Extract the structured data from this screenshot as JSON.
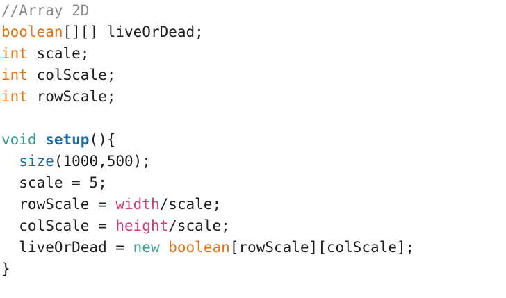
{
  "editor": {
    "colors": {
      "comment": "#8a8a8a",
      "type": "#e0761a",
      "void": "#3a9d8f",
      "function": "#1b6ba5",
      "constant": "#d23d7a",
      "text": "#1f1f1f",
      "background": "#ffffff"
    },
    "lines": [
      [
        {
          "t": "//Array 2D",
          "k": "comment"
        }
      ],
      [
        {
          "t": "boolean",
          "k": "type"
        },
        {
          "t": "[][] liveOrDead;",
          "k": "plain"
        }
      ],
      [
        {
          "t": "int",
          "k": "type"
        },
        {
          "t": " scale;",
          "k": "plain"
        }
      ],
      [
        {
          "t": "int",
          "k": "type"
        },
        {
          "t": " colScale;",
          "k": "plain"
        }
      ],
      [
        {
          "t": "int",
          "k": "type"
        },
        {
          "t": " rowScale;",
          "k": "plain"
        }
      ],
      [],
      [
        {
          "t": "void",
          "k": "void"
        },
        {
          "t": " ",
          "k": "plain"
        },
        {
          "t": "setup",
          "k": "func"
        },
        {
          "t": "(){",
          "k": "plain"
        }
      ],
      [
        {
          "t": "  ",
          "k": "plain"
        },
        {
          "t": "size",
          "k": "builtin"
        },
        {
          "t": "(1000,500);",
          "k": "plain"
        }
      ],
      [
        {
          "t": "  scale = 5;",
          "k": "plain"
        }
      ],
      [
        {
          "t": "  rowScale = ",
          "k": "plain"
        },
        {
          "t": "width",
          "k": "const"
        },
        {
          "t": "/scale;",
          "k": "plain"
        }
      ],
      [
        {
          "t": "  colScale = ",
          "k": "plain"
        },
        {
          "t": "height",
          "k": "const"
        },
        {
          "t": "/scale;",
          "k": "plain"
        }
      ],
      [
        {
          "t": "  liveOrDead = ",
          "k": "plain"
        },
        {
          "t": "new",
          "k": "new"
        },
        {
          "t": " ",
          "k": "plain"
        },
        {
          "t": "boolean",
          "k": "type"
        },
        {
          "t": "[rowScale][colScale];",
          "k": "plain"
        }
      ],
      [
        {
          "t": "}",
          "k": "plain"
        }
      ]
    ]
  }
}
